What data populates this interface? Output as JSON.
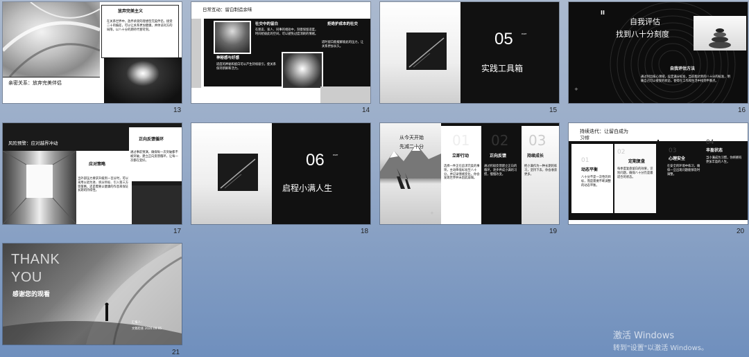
{
  "slides": {
    "s13": {
      "number": "13",
      "title": "放弃完美主义",
      "body": "在关系世界中，放弃承受的理想型完美伴侣，接受二十的偏差，可以让关系更加健康。并体谅对方的局限，以八十分的期待代替苛刻。",
      "caption": "亲密关系：放弃完美伴侣"
    },
    "s14": {
      "number": "14",
      "header": "日常互动：留白制造余味",
      "h1": "社交中的留白",
      "b1": "在朋友、家人、同事的相处中，刻意保留适度，时间给彼此的空间，可以避免过度消耗的情绪。",
      "h2": "拒绝护成本的社交",
      "b2": "适时留白能缓解彼此的压力，让关系更加长久。",
      "h3": "神秘感与好感",
      "b3": "适度的神秘和留白可以产生持续吸引，使关系保持新鲜和活力。"
    },
    "s15": {
      "number": "15",
      "big": "05",
      "mini": "PART",
      "title": "实践工具箱"
    },
    "s16": {
      "number": "16",
      "pause": "II",
      "title1": "自我评估",
      "title2": "找到八十分刻度",
      "h": "自我评估方法",
      "body": "通过列出核心领域，设定满分标准，当前能达到的八十分的标准，明确自己可以接受的状态，使得在工作和生活中找到平衡点。"
    },
    "s17": {
      "number": "17",
      "header": "风险预警：应对越界冲动",
      "h1": "应对策略",
      "b1": "当外部压力要求升级到一百分时，可以采用以退为进、拆分目标、引入第三方等策略，还是需要以健康的作息来保证长期的持续性。",
      "h2": "正向反馈循环",
      "b2": "通过事前预演，确保每一次突破都不被突破，建立正向反馈循环，让每一次都在变好。"
    },
    "s18": {
      "number": "18",
      "big": "06",
      "mini": "PART",
      "title": "启程小满人生"
    },
    "s19": {
      "number": "19",
      "header1": "从今天开始",
      "header2": "先减二十分",
      "n1": "01",
      "h1": "立即行动",
      "b1": "选择一件正在追求完美的事项，主动降低标准至八十分，并记录情绪变化，你会发现世界并未因此崩塌。",
      "n2": "02",
      "h2": "正向反馈",
      "b2": "通过积极反馈建立正向的循环，逐步养成小满的习惯，慢慢改变。",
      "n3": "03",
      "h3": "持续成长",
      "b3": "把小满作为一种长期的练习，坚持下去，你会收获更多。"
    },
    "s20": {
      "number": "20",
      "header1": "持续迭代：让留白成为",
      "header2": "习惯",
      "n1": "01",
      "h1": "动态平衡",
      "b1": "八十分不是一次性的目标，而是需要不断调整的动态平衡。",
      "n2": "02",
      "h2": "定期复盘",
      "b2": "每季度复盘留白的效果，识别问题，确保八十分仍是最适合的状态。",
      "n3": "03",
      "h3": "心理安全",
      "b3": "在安全的环境中练习，确保一旦出现问题能够及时调整。",
      "n4": "04",
      "h4": "丰盈状态",
      "b4": "当小满成为习惯，你将拥有更加丰盈的人生。"
    },
    "s21": {
      "number": "21",
      "thank": "THANK",
      "you": "YOU",
      "title": "感谢您的观看",
      "reporter": "汇报人：",
      "meta": "文稿检查   2026.08.05"
    }
  },
  "watermark": {
    "line1": "激活 Windows",
    "line2": "转到\"设置\"以激活 Windows。"
  },
  "colors": {
    "dark": "#111111",
    "white": "#ffffff",
    "background_top": "#aab9cf",
    "background_bottom": "#6f8fbd"
  }
}
